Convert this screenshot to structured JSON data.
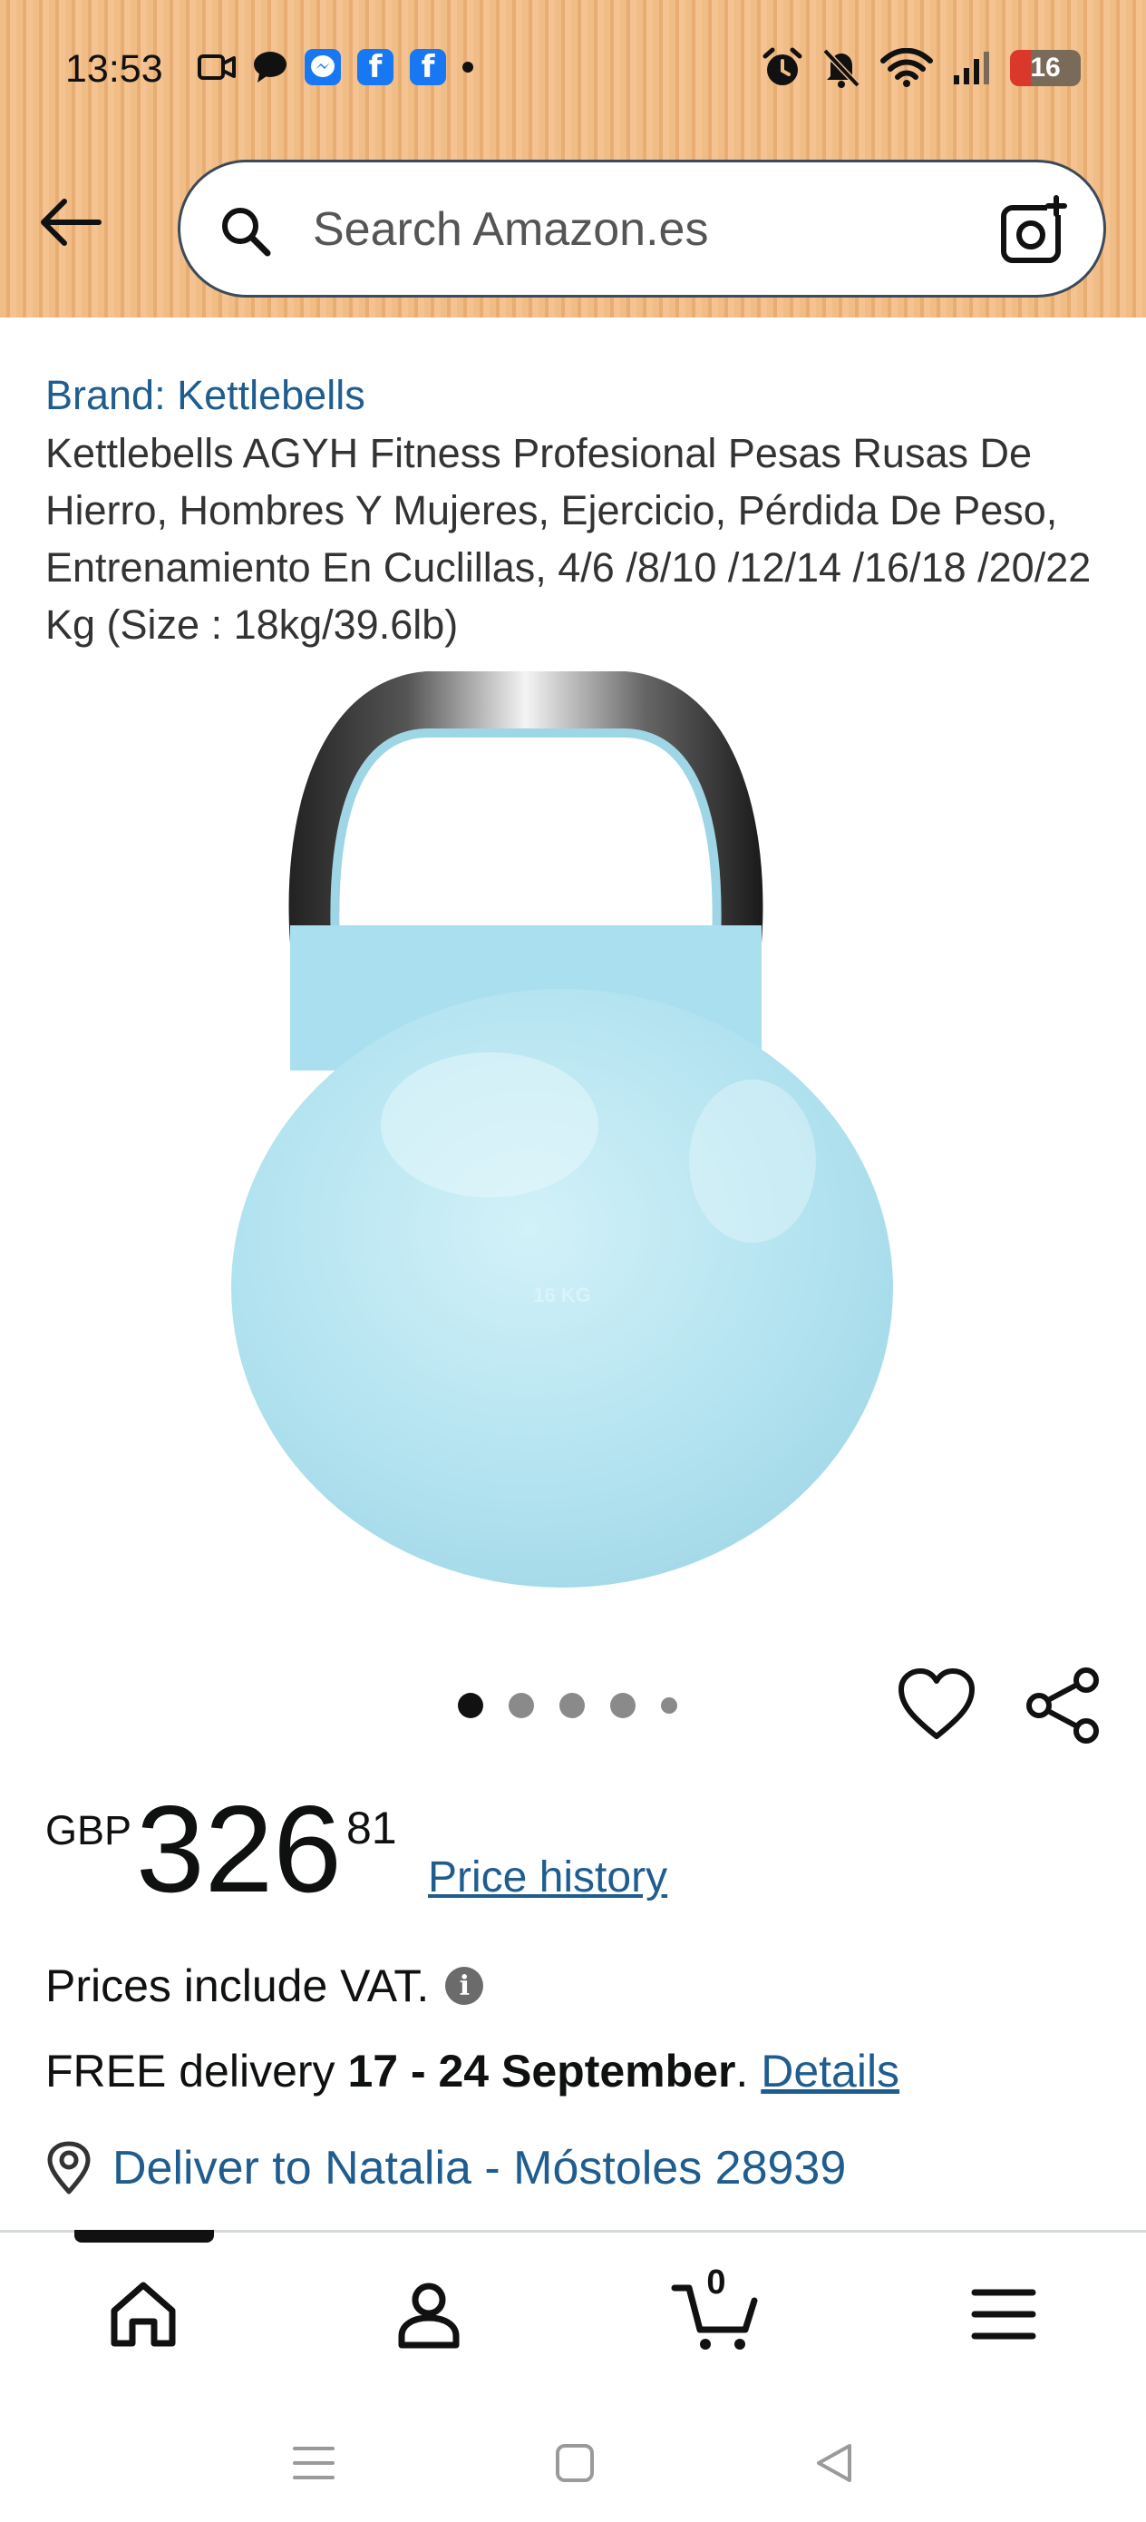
{
  "status_bar": {
    "time": "13:53",
    "battery_level": "16",
    "left_icons": [
      "video-icon",
      "chat-bubble-icon",
      "messenger-icon",
      "facebook-icon",
      "facebook-icon",
      "dot-icon"
    ],
    "right_icons": [
      "alarm-icon",
      "bell-muted-icon",
      "wifi-icon",
      "signal-icon",
      "battery-icon"
    ]
  },
  "header": {
    "search_placeholder": "Search Amazon.es",
    "icons": [
      "back-arrow-icon",
      "search-icon",
      "camera-search-icon"
    ]
  },
  "product": {
    "brand": "Brand: Kettlebells",
    "title": "Kettlebells AGYH Fitness Profesional Pesas Rusas De Hierro, Hombres Y Mujeres, Ejercicio, Pérdida De Peso, Entrenamiento En Cuclillas, 4/6 /8/10 /12/14 /16/18 /20/22 Kg (Size : 18kg/39.6lb)",
    "image_weight_label": "16 KG",
    "carousel": {
      "total": 5,
      "active": 1
    }
  },
  "price": {
    "currency": "GBP",
    "whole": "326",
    "fraction": "81",
    "history_link": "Price history"
  },
  "vat_text": "Prices include VAT.",
  "delivery": {
    "prefix": "FREE delivery ",
    "dates": "17 - 24 September",
    "suffix": ". ",
    "details_link": "Details"
  },
  "deliver_to": "Deliver to Natalia - Móstoles 28939",
  "bottom_nav": {
    "items": [
      "home-icon",
      "account-icon",
      "cart-icon",
      "menu-icon"
    ],
    "cart_count": "0"
  },
  "colors": {
    "link": "#1f5d8f",
    "header_bg": "#f1bd86",
    "kettlebell": "#b3e3f0"
  }
}
